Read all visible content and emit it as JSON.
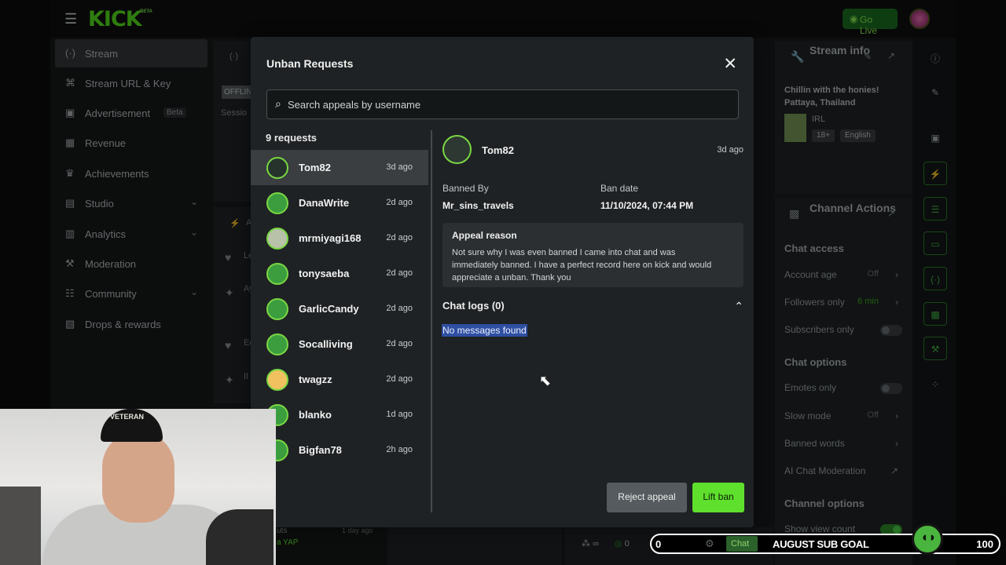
{
  "brand": {
    "logo": "KICK",
    "logo_badge": "BETA",
    "go_live": "Go Live"
  },
  "sidebar": {
    "items": [
      {
        "label": "Stream",
        "icon": "broadcast-icon",
        "active": true
      },
      {
        "label": "Stream URL & Key",
        "icon": "link-icon"
      },
      {
        "label": "Advertisement",
        "icon": "ad-icon",
        "badge": "Beta"
      },
      {
        "label": "Revenue",
        "icon": "dollar-icon"
      },
      {
        "label": "Achievements",
        "icon": "trophy-icon"
      },
      {
        "label": "Studio",
        "icon": "studio-icon",
        "has_chevron": true
      },
      {
        "label": "Analytics",
        "icon": "chart-icon",
        "has_chevron": true
      },
      {
        "label": "Moderation",
        "icon": "wrench-icon"
      },
      {
        "label": "Community",
        "icon": "community-icon",
        "has_chevron": true
      },
      {
        "label": "Drops & rewards",
        "icon": "gift-icon"
      }
    ]
  },
  "background_left": {
    "offline_badge": "OFFLIN",
    "session_label": "Sessio",
    "feed": [
      "Le",
      "Ay",
      "Ec",
      "Il"
    ],
    "panel_letter_a": "A",
    "bottom_user": "uts",
    "bottom_tag": "a YAP",
    "bottom_time": "1 day ago"
  },
  "modal": {
    "title": "Unban Requests",
    "search_placeholder": "Search appeals by username",
    "request_count": "9 requests",
    "requests": [
      {
        "name": "Tom82",
        "time": "3d ago",
        "active": true
      },
      {
        "name": "DanaWrite",
        "time": "2d ago"
      },
      {
        "name": "mrmiyagi168",
        "time": "2d ago"
      },
      {
        "name": "tonysaeba",
        "time": "2d ago"
      },
      {
        "name": "GarlicCandy",
        "time": "2d ago"
      },
      {
        "name": "Socalliving",
        "time": "2d ago"
      },
      {
        "name": "twagzz",
        "time": "2d ago"
      },
      {
        "name": "blanko",
        "time": "1d ago"
      },
      {
        "name": "Bigfan78",
        "time": "2h ago"
      }
    ],
    "detail": {
      "name": "Tom82",
      "time": "3d ago",
      "banned_by_label": "Banned By",
      "banned_by": "Mr_sins_travels",
      "ban_date_label": "Ban date",
      "ban_date": "11/10/2024, 07:44 PM",
      "appeal_title": "Appeal reason",
      "appeal_text": "Not sure why I was even banned I came into chat and was immediately banned. I have a perfect record here on kick and would appreciate a unban. Thank you",
      "chat_logs": "Chat logs (0)",
      "no_messages": "No messages found"
    },
    "buttons": {
      "reject": "Reject appeal",
      "lift": "Lift ban"
    }
  },
  "stream_info": {
    "title": "Stream info",
    "description": "Chillin with the honies! Pattaya, Thailand",
    "category": "IRL",
    "tags": [
      "18+",
      "English"
    ]
  },
  "channel_actions": {
    "title": "Channel Actions",
    "chat_access_title": "Chat access",
    "account_age": "Account age",
    "account_age_value": "Off",
    "followers_only": "Followers only",
    "followers_only_value": "6 min",
    "subscribers_only": "Subscribers only",
    "chat_options_title": "Chat options",
    "emotes_only": "Emotes only",
    "slow_mode": "Slow mode",
    "slow_mode_value": "Off",
    "banned_words": "Banned words",
    "ai_moderation": "AI Chat Moderation",
    "channel_options_title": "Channel options",
    "show_view_count": "Show view count"
  },
  "bottom": {
    "goal_current": "0",
    "chat_button": "Chat",
    "goal_label": "AUGUST SUB GOAL",
    "goal_target": "100",
    "viewer_count": "0",
    "viewer_symbol": "∞"
  },
  "webcam": {
    "hat_text": "VETERAN"
  }
}
